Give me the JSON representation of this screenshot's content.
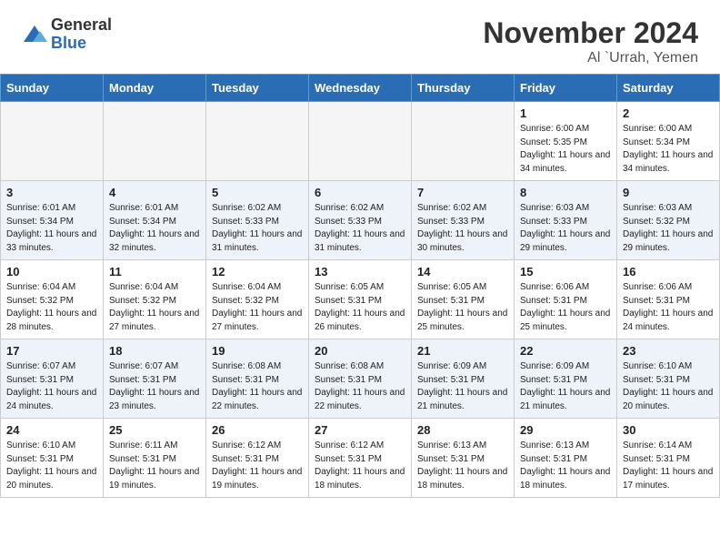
{
  "header": {
    "logo_general": "General",
    "logo_blue": "Blue",
    "month": "November 2024",
    "location": "Al `Urrah, Yemen"
  },
  "weekdays": [
    "Sunday",
    "Monday",
    "Tuesday",
    "Wednesday",
    "Thursday",
    "Friday",
    "Saturday"
  ],
  "weeks": [
    [
      {
        "day": "",
        "info": ""
      },
      {
        "day": "",
        "info": ""
      },
      {
        "day": "",
        "info": ""
      },
      {
        "day": "",
        "info": ""
      },
      {
        "day": "",
        "info": ""
      },
      {
        "day": "1",
        "info": "Sunrise: 6:00 AM\nSunset: 5:35 PM\nDaylight: 11 hours and 34 minutes."
      },
      {
        "day": "2",
        "info": "Sunrise: 6:00 AM\nSunset: 5:34 PM\nDaylight: 11 hours and 34 minutes."
      }
    ],
    [
      {
        "day": "3",
        "info": "Sunrise: 6:01 AM\nSunset: 5:34 PM\nDaylight: 11 hours and 33 minutes."
      },
      {
        "day": "4",
        "info": "Sunrise: 6:01 AM\nSunset: 5:34 PM\nDaylight: 11 hours and 32 minutes."
      },
      {
        "day": "5",
        "info": "Sunrise: 6:02 AM\nSunset: 5:33 PM\nDaylight: 11 hours and 31 minutes."
      },
      {
        "day": "6",
        "info": "Sunrise: 6:02 AM\nSunset: 5:33 PM\nDaylight: 11 hours and 31 minutes."
      },
      {
        "day": "7",
        "info": "Sunrise: 6:02 AM\nSunset: 5:33 PM\nDaylight: 11 hours and 30 minutes."
      },
      {
        "day": "8",
        "info": "Sunrise: 6:03 AM\nSunset: 5:33 PM\nDaylight: 11 hours and 29 minutes."
      },
      {
        "day": "9",
        "info": "Sunrise: 6:03 AM\nSunset: 5:32 PM\nDaylight: 11 hours and 29 minutes."
      }
    ],
    [
      {
        "day": "10",
        "info": "Sunrise: 6:04 AM\nSunset: 5:32 PM\nDaylight: 11 hours and 28 minutes."
      },
      {
        "day": "11",
        "info": "Sunrise: 6:04 AM\nSunset: 5:32 PM\nDaylight: 11 hours and 27 minutes."
      },
      {
        "day": "12",
        "info": "Sunrise: 6:04 AM\nSunset: 5:32 PM\nDaylight: 11 hours and 27 minutes."
      },
      {
        "day": "13",
        "info": "Sunrise: 6:05 AM\nSunset: 5:31 PM\nDaylight: 11 hours and 26 minutes."
      },
      {
        "day": "14",
        "info": "Sunrise: 6:05 AM\nSunset: 5:31 PM\nDaylight: 11 hours and 25 minutes."
      },
      {
        "day": "15",
        "info": "Sunrise: 6:06 AM\nSunset: 5:31 PM\nDaylight: 11 hours and 25 minutes."
      },
      {
        "day": "16",
        "info": "Sunrise: 6:06 AM\nSunset: 5:31 PM\nDaylight: 11 hours and 24 minutes."
      }
    ],
    [
      {
        "day": "17",
        "info": "Sunrise: 6:07 AM\nSunset: 5:31 PM\nDaylight: 11 hours and 24 minutes."
      },
      {
        "day": "18",
        "info": "Sunrise: 6:07 AM\nSunset: 5:31 PM\nDaylight: 11 hours and 23 minutes."
      },
      {
        "day": "19",
        "info": "Sunrise: 6:08 AM\nSunset: 5:31 PM\nDaylight: 11 hours and 22 minutes."
      },
      {
        "day": "20",
        "info": "Sunrise: 6:08 AM\nSunset: 5:31 PM\nDaylight: 11 hours and 22 minutes."
      },
      {
        "day": "21",
        "info": "Sunrise: 6:09 AM\nSunset: 5:31 PM\nDaylight: 11 hours and 21 minutes."
      },
      {
        "day": "22",
        "info": "Sunrise: 6:09 AM\nSunset: 5:31 PM\nDaylight: 11 hours and 21 minutes."
      },
      {
        "day": "23",
        "info": "Sunrise: 6:10 AM\nSunset: 5:31 PM\nDaylight: 11 hours and 20 minutes."
      }
    ],
    [
      {
        "day": "24",
        "info": "Sunrise: 6:10 AM\nSunset: 5:31 PM\nDaylight: 11 hours and 20 minutes."
      },
      {
        "day": "25",
        "info": "Sunrise: 6:11 AM\nSunset: 5:31 PM\nDaylight: 11 hours and 19 minutes."
      },
      {
        "day": "26",
        "info": "Sunrise: 6:12 AM\nSunset: 5:31 PM\nDaylight: 11 hours and 19 minutes."
      },
      {
        "day": "27",
        "info": "Sunrise: 6:12 AM\nSunset: 5:31 PM\nDaylight: 11 hours and 18 minutes."
      },
      {
        "day": "28",
        "info": "Sunrise: 6:13 AM\nSunset: 5:31 PM\nDaylight: 11 hours and 18 minutes."
      },
      {
        "day": "29",
        "info": "Sunrise: 6:13 AM\nSunset: 5:31 PM\nDaylight: 11 hours and 18 minutes."
      },
      {
        "day": "30",
        "info": "Sunrise: 6:14 AM\nSunset: 5:31 PM\nDaylight: 11 hours and 17 minutes."
      }
    ]
  ]
}
